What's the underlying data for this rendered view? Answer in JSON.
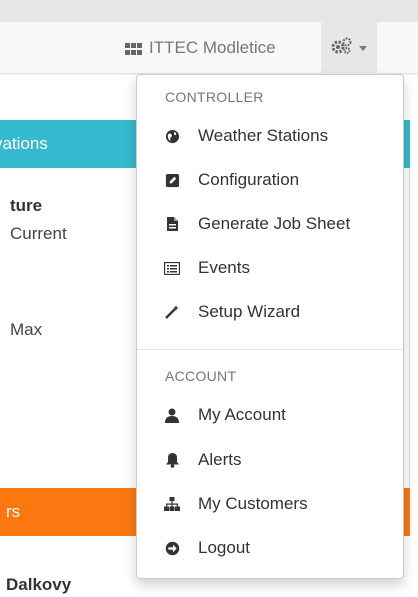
{
  "navbar": {
    "brand": "ITTEC Modletice",
    "brand_icon": "grid-icon",
    "settings_icon": "gears-icon"
  },
  "panel_observations": {
    "heading": "vations",
    "label": "ture",
    "current_label": "Current",
    "max_label": "Max"
  },
  "panel_orange": {
    "heading": "rs",
    "name": "Dalkovy"
  },
  "dropdown": {
    "controller_header": "CONTROLLER",
    "controller_items": [
      {
        "label": "Weather Stations",
        "icon": "globe-icon"
      },
      {
        "label": "Configuration",
        "icon": "edit-icon"
      },
      {
        "label": "Generate Job Sheet",
        "icon": "file-icon"
      },
      {
        "label": "Events",
        "icon": "list-icon"
      },
      {
        "label": "Setup Wizard",
        "icon": "magic-wand-icon"
      }
    ],
    "account_header": "ACCOUNT",
    "account_items": [
      {
        "label": "My Account",
        "icon": "user-icon"
      },
      {
        "label": "Alerts",
        "icon": "bell-icon"
      },
      {
        "label": "My Customers",
        "icon": "sitemap-icon"
      },
      {
        "label": "Logout",
        "icon": "logout-icon"
      }
    ]
  },
  "colors": {
    "teal_panel": "#34b9ce",
    "orange_panel": "#fb7710",
    "icon_dark": "#333333",
    "muted_text": "#777777"
  }
}
